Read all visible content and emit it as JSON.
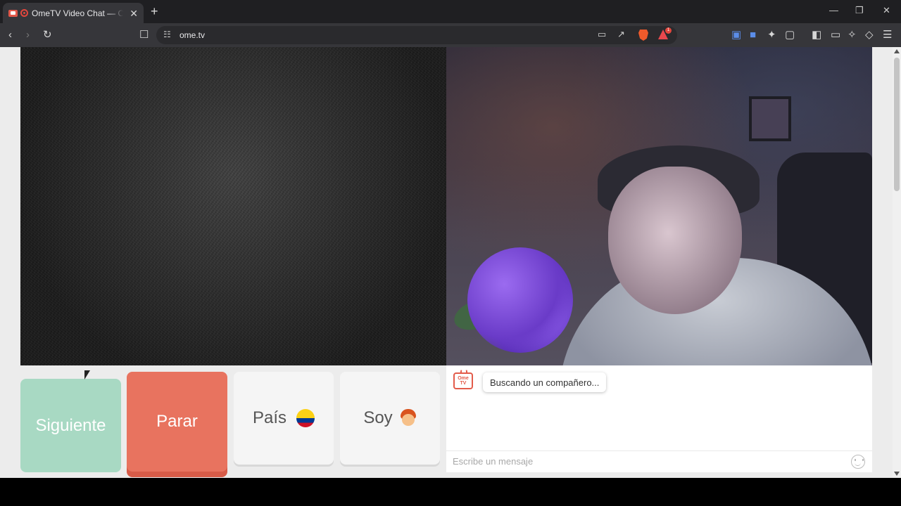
{
  "browser": {
    "tab_title": "OmeTV Video Chat — Omegle",
    "tab_close": "✕",
    "new_tab": "+",
    "url": "ome.tv",
    "window_controls": {
      "minimize": "—",
      "maximize": "❐",
      "close": "✕"
    },
    "reward_badge": "1"
  },
  "buttons": {
    "next": "Siguiente",
    "stop": "Parar",
    "country": "País",
    "gender": "Soy"
  },
  "chat": {
    "logo_text_1": "Ome",
    "logo_text_2": "TV",
    "status_message": "Buscando un compañero...",
    "input_placeholder": "Escribe un mensaje"
  },
  "icons": {
    "back": "back-arrow-icon",
    "forward": "forward-arrow-icon",
    "reload": "reload-icon",
    "bookmark": "bookmark-icon",
    "country_flag": "colombia-flag-icon",
    "gender": "boy-emoji-icon",
    "emoji": "emoji-smile-icon"
  },
  "colors": {
    "next": "#a8d9c3",
    "stop": "#e8735f",
    "neutral_button": "#f5f5f5"
  }
}
